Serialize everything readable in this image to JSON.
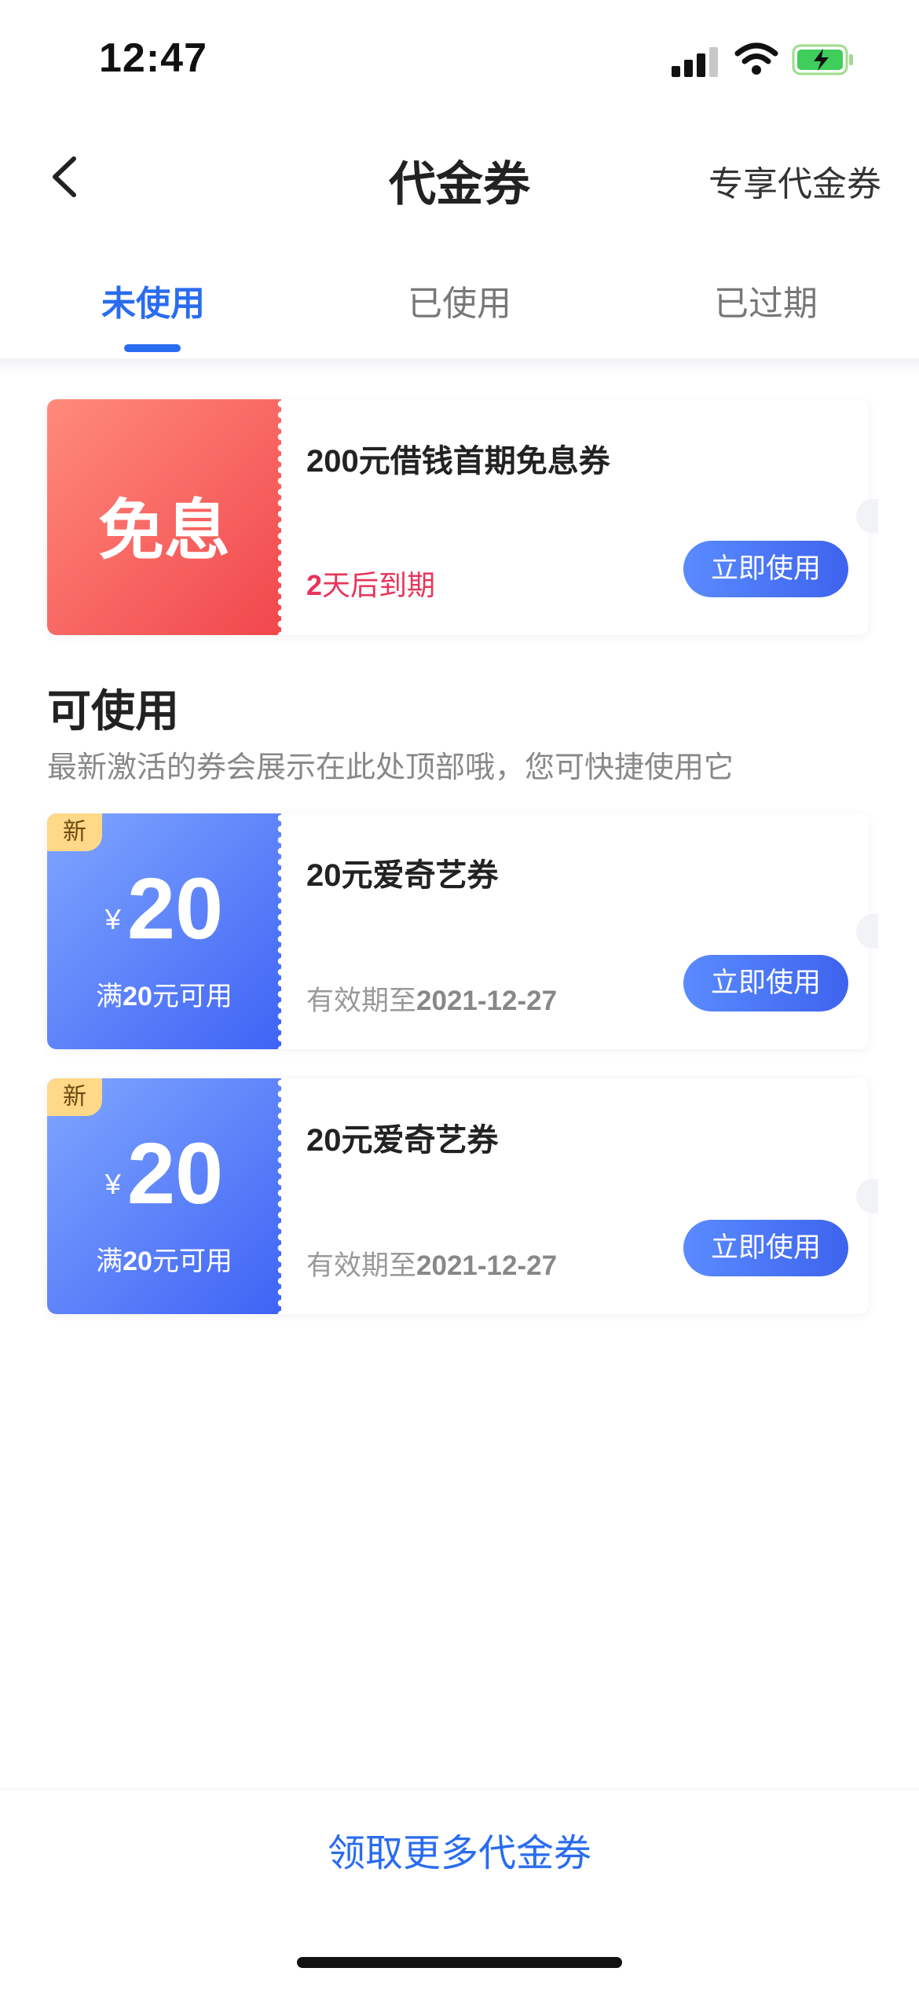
{
  "status_bar": {
    "time": "12:47"
  },
  "nav": {
    "title": "代金券",
    "right_label": "专享代金券"
  },
  "tabs": [
    {
      "label": "未使用",
      "active": true
    },
    {
      "label": "已使用",
      "active": false
    },
    {
      "label": "已过期",
      "active": false
    }
  ],
  "featured": {
    "tag": "免息",
    "title": "200元借钱首期免息券",
    "expire_count": "2",
    "expire_suffix": "天后到期",
    "button": "立即使用"
  },
  "section": {
    "title": "可使用",
    "desc": "最新激活的券会展示在此处顶部哦，您可快捷使用它"
  },
  "coupons": [
    {
      "badge": "新",
      "currency": "¥",
      "amount": "20",
      "cond_prefix": "满",
      "cond_value": "20",
      "cond_suffix": "元可用",
      "title": "20元爱奇艺券",
      "valid_label": "有效期至",
      "valid_date": "2021-12-27",
      "button": "立即使用"
    },
    {
      "badge": "新",
      "currency": "¥",
      "amount": "20",
      "cond_prefix": "满",
      "cond_value": "20",
      "cond_suffix": "元可用",
      "title": "20元爱奇艺券",
      "valid_label": "有效期至",
      "valid_date": "2021-12-27",
      "button": "立即使用"
    }
  ],
  "bottom": {
    "link": "领取更多代金券"
  },
  "colors": {
    "accent": "#2a6cf0",
    "danger": "#e8345a"
  },
  "icons": [
    "signal-icon",
    "wifi-icon",
    "battery-charging-icon",
    "back-arrow-icon"
  ]
}
